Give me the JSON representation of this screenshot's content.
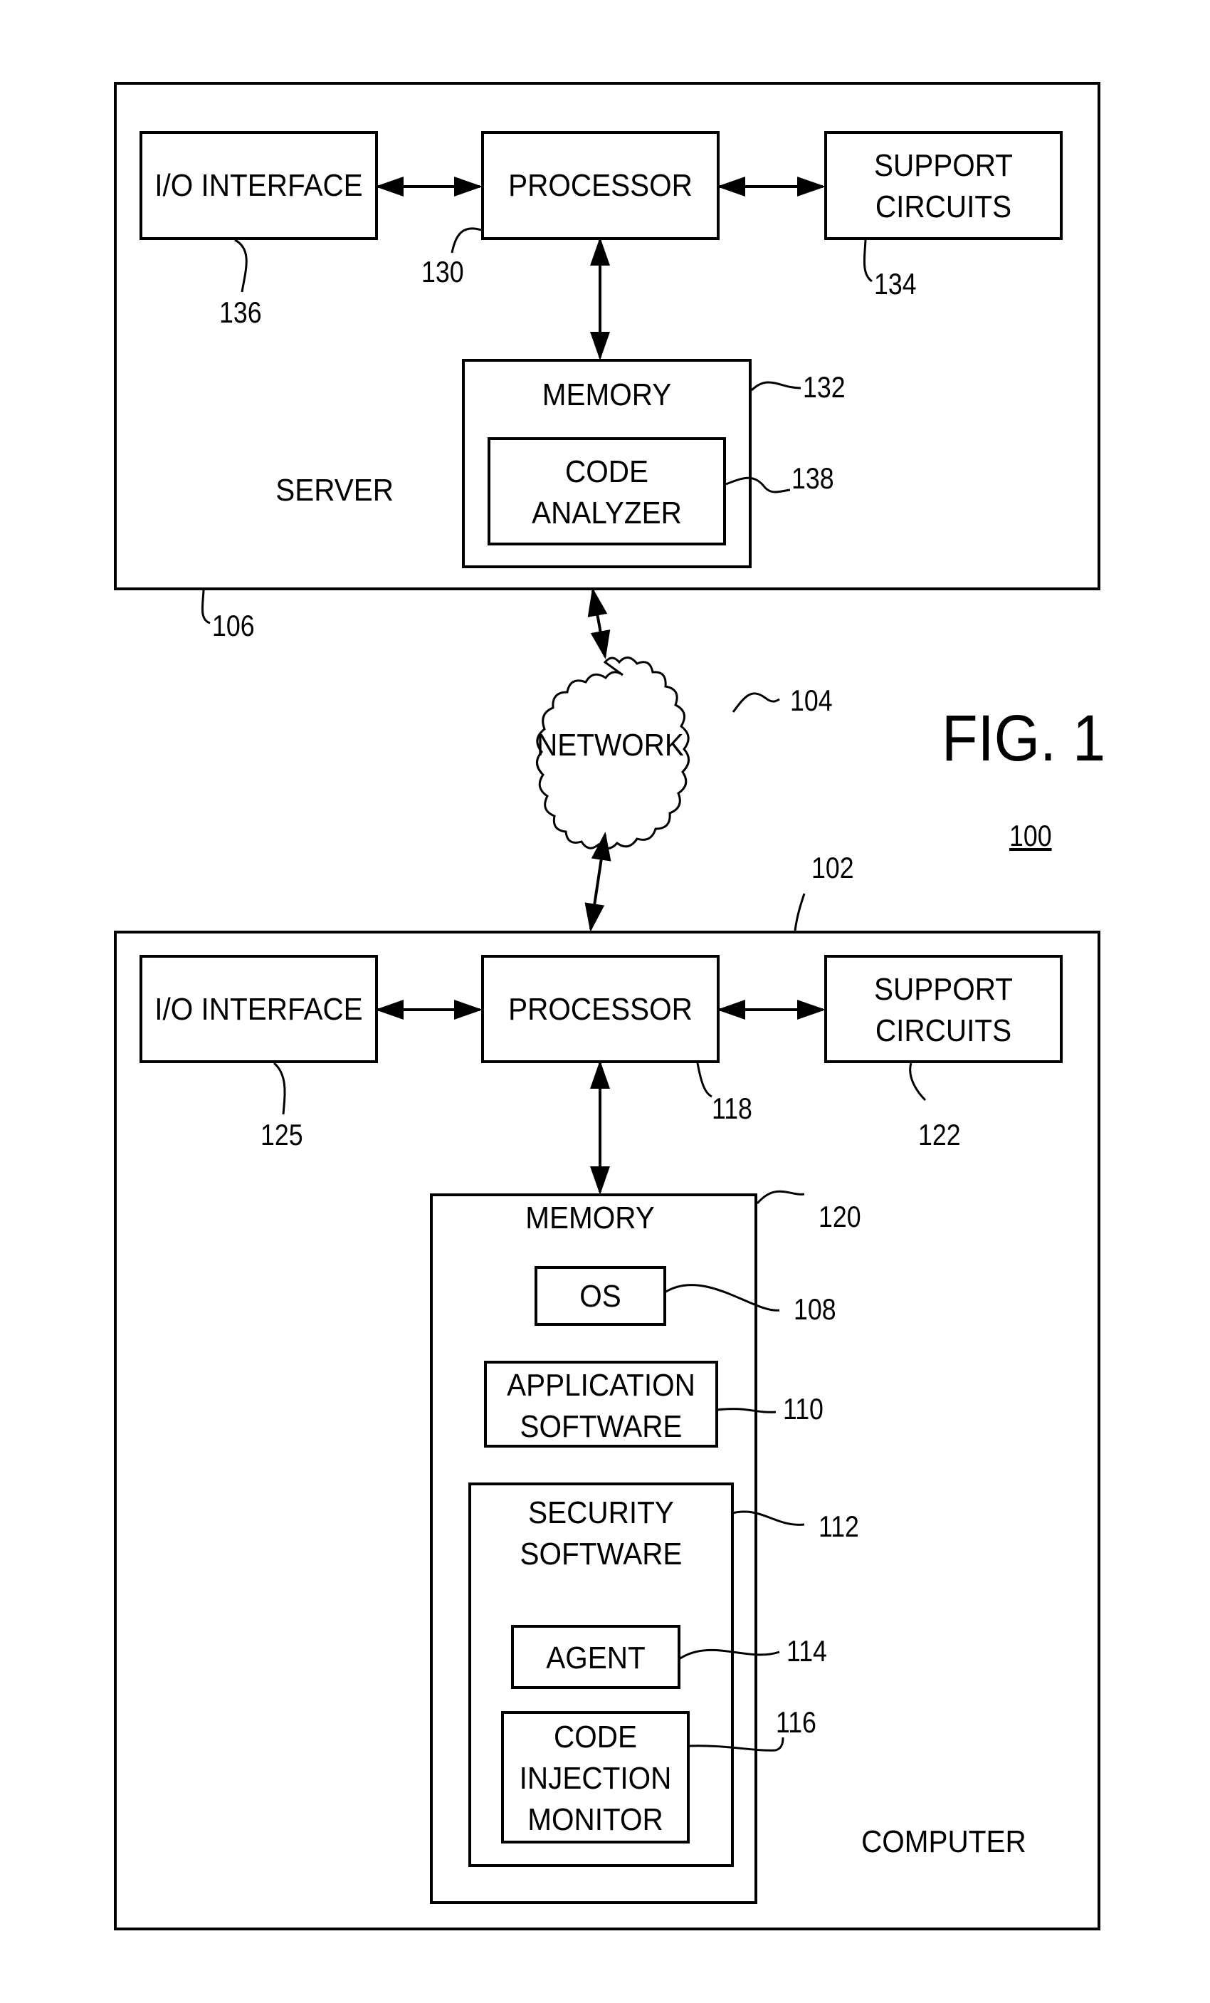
{
  "figure": {
    "title": "FIG. 1",
    "system_ref": "100"
  },
  "server": {
    "label": "SERVER",
    "ref": "106",
    "io_interface": {
      "label": "I/O INTERFACE",
      "ref": "136"
    },
    "processor": {
      "label": "PROCESSOR",
      "ref": "130"
    },
    "support_circuits": {
      "label": "SUPPORT\nCIRCUITS",
      "ref": "134"
    },
    "memory": {
      "label": "MEMORY",
      "ref": "132"
    },
    "code_analyzer": {
      "label": "CODE\nANALYZER",
      "ref": "138"
    }
  },
  "network": {
    "label": "NETWORK",
    "ref": "104"
  },
  "computer": {
    "label": "COMPUTER",
    "ref": "102",
    "io_interface": {
      "label": "I/O INTERFACE",
      "ref": "125"
    },
    "processor": {
      "label": "PROCESSOR",
      "ref": "118"
    },
    "support_circuits": {
      "label": "SUPPORT\nCIRCUITS",
      "ref": "122"
    },
    "memory": {
      "label": "MEMORY",
      "ref": "120"
    },
    "os": {
      "label": "OS",
      "ref": "108"
    },
    "application_software": {
      "label": "APPLICATION\nSOFTWARE",
      "ref": "110"
    },
    "security_software": {
      "label": "SECURITY\nSOFTWARE",
      "ref": "112"
    },
    "agent": {
      "label": "AGENT",
      "ref": "114"
    },
    "code_injection_monitor": {
      "label": "CODE\nINJECTION\nMONITOR",
      "ref": "116"
    }
  }
}
